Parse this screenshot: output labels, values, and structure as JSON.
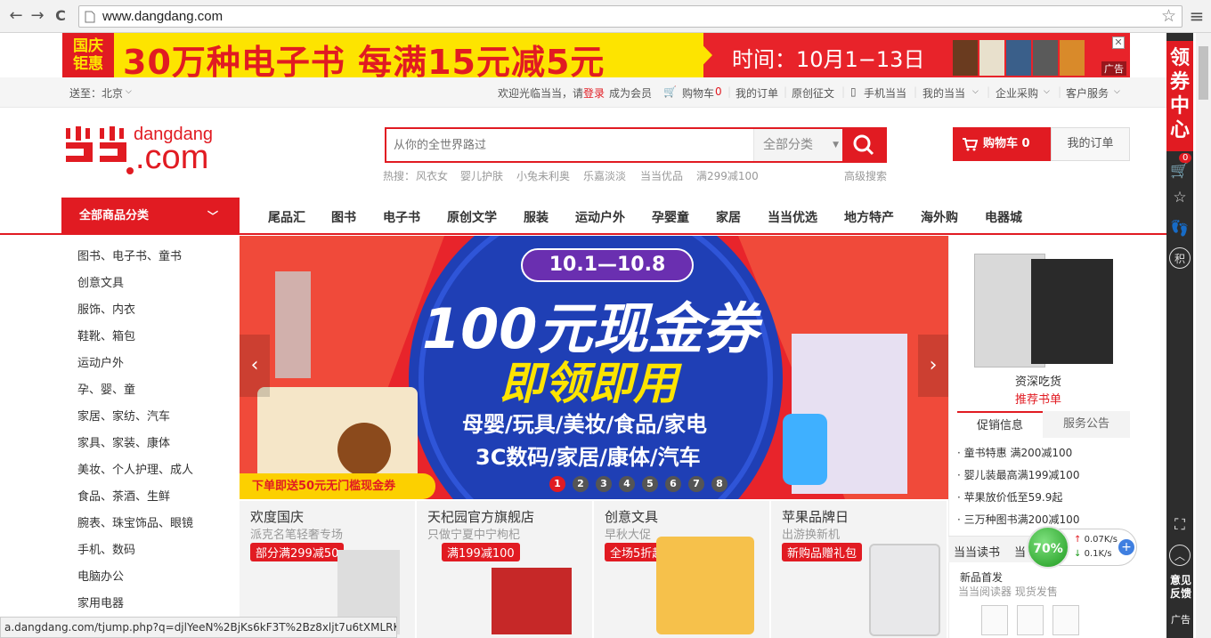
{
  "browser": {
    "url": "www.dangdang.com",
    "back": "←",
    "forward": "→",
    "reload": "C",
    "star": "☆",
    "menu": "≡"
  },
  "ad_banner": {
    "left_line1": "国庆",
    "left_line2": "钜惠",
    "headline": "30万种电子书 每满15元减5元",
    "time_text": "时间：10月1−13日",
    "tag": "广告",
    "close": "✕"
  },
  "topbar": {
    "deliver_to": "送至：北京",
    "welcome": "欢迎光临当当，请",
    "login": "登录",
    "register": "成为会员",
    "cart": "购物车",
    "cart_count": "0",
    "my_orders": "我的订单",
    "original": "原创征文",
    "mobile": "手机当当",
    "my_dangdang": "我的当当",
    "enterprise": "企业采购",
    "service": "客户服务"
  },
  "header": {
    "logo_text": "dangdang",
    "logo_com": ".com",
    "search_placeholder": "从你的全世界路过",
    "search_category": "全部分类",
    "hot_label": "热搜：",
    "hot_words": [
      "风衣女",
      "婴儿护肤",
      "小兔未利奥",
      "乐嘉淡淡",
      "当当优品",
      "满299减100"
    ],
    "advanced_search": "高级搜索",
    "cart_button": "购物车 0",
    "order_button": "我的订单"
  },
  "nav": {
    "all_categories": "全部商品分类",
    "items": [
      "尾品汇",
      "图书",
      "电子书",
      "原创文学",
      "服装",
      "运动户外",
      "孕婴童",
      "家居",
      "当当优选",
      "地方特产",
      "海外购",
      "电器城"
    ]
  },
  "sidebar": {
    "items": [
      "图书、电子书、童书",
      "创意文具",
      "服饰、内衣",
      "鞋靴、箱包",
      "运动户外",
      "孕、婴、童",
      "家居、家纺、汽车",
      "家具、家装、康体",
      "美妆、个人护理、成人",
      "食品、茶酒、生鲜",
      "腕表、珠宝饰品、眼镜",
      "手机、数码",
      "电脑办公",
      "家用电器"
    ]
  },
  "hero": {
    "date_range": "10.1—10.8",
    "title": "100元现金券",
    "subtitle": "即领即用",
    "line1": "母婴/玩具/美妆/食品/家电",
    "line2": "3C数码/家居/康体/汽车",
    "promo": "下单即送50元无门槛现金券",
    "dots": [
      "1",
      "2",
      "3",
      "4",
      "5",
      "6",
      "7",
      "8"
    ],
    "active_dot": 1,
    "prev": "‹",
    "next": "›"
  },
  "right_panel": {
    "book_caption": "资深吃货",
    "book_link": "推荐书单",
    "tabs": [
      "促销信息",
      "服务公告"
    ],
    "promos": [
      "童书特惠 满200减100",
      "婴儿装最高满199减100",
      "苹果放价低至59.9起",
      "三万种图书满200减100"
    ],
    "reading_tabs": [
      "当当读书",
      "当"
    ],
    "new_release": "新品首发",
    "reader_promo": "当当阅读器 现货发售"
  },
  "tiles": [
    {
      "title": "欢度国庆",
      "subtitle": "派克名笔轻奢专场",
      "tag": "部分满299减50"
    },
    {
      "title": "天杞园官方旗舰店",
      "subtitle": "只做宁夏中宁枸杞",
      "tag": "满199减100"
    },
    {
      "title": "创意文具",
      "subtitle": "早秋大促",
      "tag": "全场5折起"
    },
    {
      "title": "苹果品牌日",
      "subtitle": "出游换新机",
      "tag": "新购品赠礼包"
    }
  ],
  "right_float": {
    "coupon": [
      "领",
      "券",
      "中",
      "心"
    ],
    "cart_badge": "0",
    "feedback": "意见反馈",
    "ad": "广告"
  },
  "speed_widget": {
    "percent": "70%",
    "up": "0.07K/s",
    "down": "0.1K/s"
  },
  "status_bar": "a.dangdang.com/tjump.php?q=djlYeeN%2BjKs6kF3T%2Bz8xljt7u6tXMLRKy..."
}
